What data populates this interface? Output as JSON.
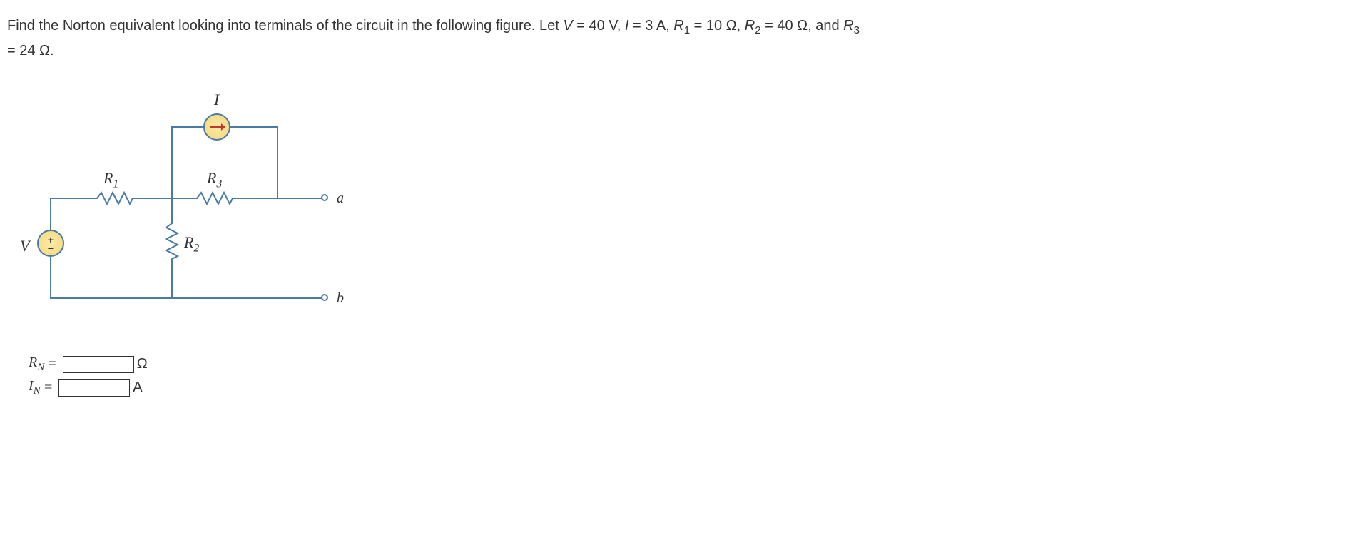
{
  "problem": {
    "text_prefix": "Find the Norton equivalent looking into terminals of the circuit in the following figure. Let ",
    "V_sym": "V",
    "eq": "= 40 V, ",
    "I_sym": "I",
    "I_val": "= 3 A, ",
    "R1_sym": "R",
    "R1_sub": "1",
    "R1_val": " = 10 Ω, ",
    "R2_sym": "R",
    "R2_sub": "2",
    "R2_val": " = 40 Ω, and ",
    "R3_sym": "R",
    "R3_sub": "3",
    "R3_ln2_prefix": "= 24 Ω."
  },
  "labels": {
    "I": "I",
    "R1": "R",
    "R1_sub": "1",
    "R2": "R",
    "R2_sub": "2",
    "R3": "R",
    "R3_sub": "3",
    "V": "V",
    "a": "a",
    "b": "b"
  },
  "answers": {
    "RN_label": "R",
    "RN_sub": "N",
    "RN_eq": "=",
    "RN_unit": "Ω",
    "IN_label": "I",
    "IN_sub": "N",
    "IN_eq": "=",
    "IN_unit": "A",
    "RN_value": "",
    "IN_value": ""
  }
}
